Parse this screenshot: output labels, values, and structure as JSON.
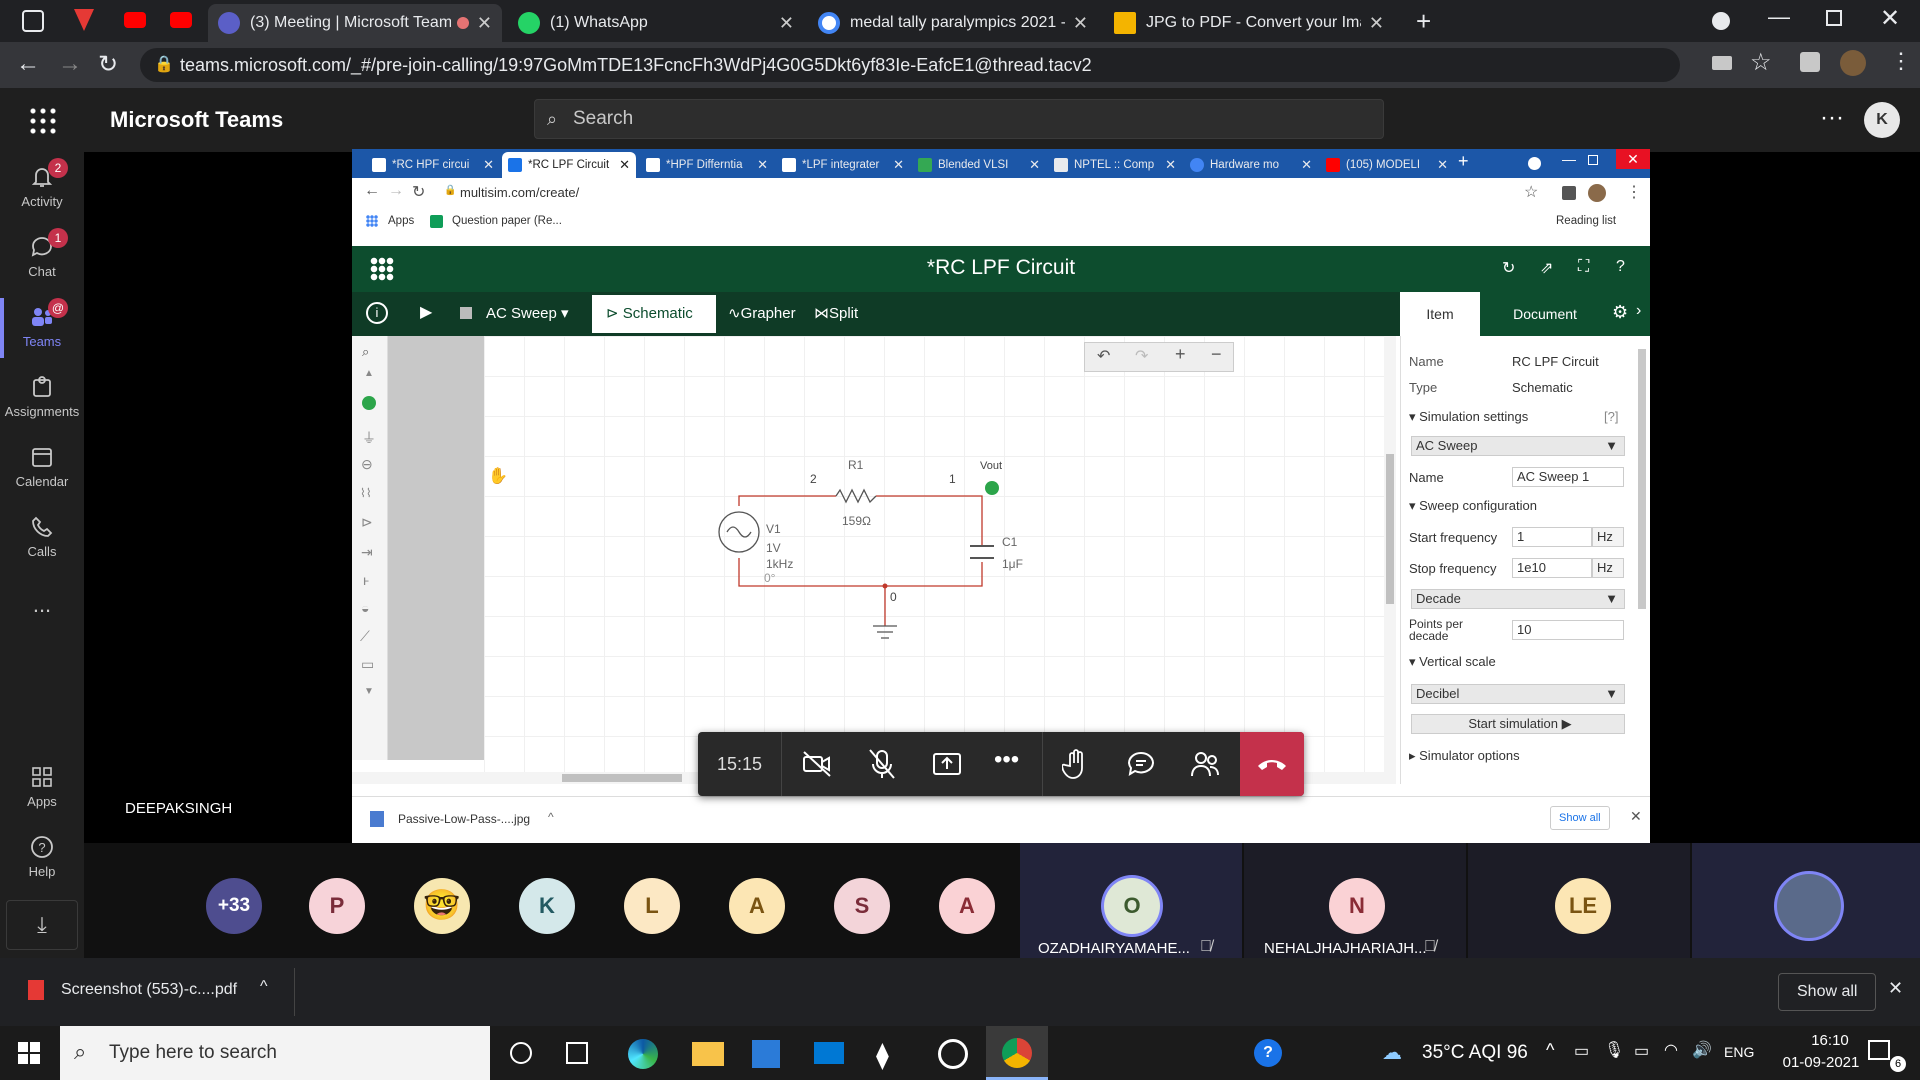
{
  "outer_browser": {
    "tabs": [
      {
        "title": "(3) Meeting | Microsoft Teams",
        "active": true,
        "fav": "#5b5fc7"
      },
      {
        "title": "(1) WhatsApp",
        "active": false,
        "fav": "#25d366"
      },
      {
        "title": "medal tally paralympics 2021 - G",
        "active": false,
        "fav": "#ffffff"
      },
      {
        "title": "JPG to PDF - Convert your Image",
        "active": false,
        "fav": "#f4b400"
      }
    ],
    "url": "teams.microsoft.com/_#/pre-join-calling/19:97GoMmTDE13FcncFh3WdPj4G0G5Dkt6yf83Ie-EafcE1@thread.tacv2"
  },
  "teams": {
    "app_title": "Microsoft Teams",
    "search_placeholder": "Search",
    "user_initial": "K",
    "rail": [
      {
        "label": "Activity",
        "badge": "2"
      },
      {
        "label": "Chat",
        "badge": "1"
      },
      {
        "label": "Teams",
        "badge": "@"
      },
      {
        "label": "Assignments",
        "badge": ""
      },
      {
        "label": "Calendar",
        "badge": ""
      },
      {
        "label": "Calls",
        "badge": ""
      },
      {
        "label": "...",
        "badge": ""
      },
      {
        "label": "Apps",
        "badge": ""
      },
      {
        "label": "Help",
        "badge": ""
      }
    ],
    "presenter_name": "DEEPAKSINGH"
  },
  "shared_screen": {
    "tabs": [
      {
        "title": "*RC HPF circui",
        "fav": "#1a73e8"
      },
      {
        "title": "*RC LPF Circuit",
        "fav": "#1a73e8",
        "active": true
      },
      {
        "title": "*HPF Differntia",
        "fav": "#1a73e8"
      },
      {
        "title": "*LPF integrater",
        "fav": "#1a73e8"
      },
      {
        "title": "Blended VLSI",
        "fav": "#34a853"
      },
      {
        "title": "NPTEL :: Comp",
        "fav": "#e8eaed"
      },
      {
        "title": "Hardware mo",
        "fav": "#4285f4"
      },
      {
        "title": "(105) MODELI",
        "fav": "#ff0000"
      }
    ],
    "url": "multisim.com/create/",
    "bookmarks": [
      "Apps",
      "Question paper (Re..."
    ],
    "reading_list": "Reading list",
    "multisim": {
      "title": "*RC LPF Circuit",
      "analysis": "AC Sweep",
      "views": [
        "Schematic",
        "Grapher",
        "Split"
      ],
      "panel_tabs": [
        "Item",
        "Document"
      ],
      "props": {
        "name_label": "Name",
        "name_value": "RC LPF Circuit",
        "type_label": "Type",
        "type_value": "Schematic",
        "sim_settings": "Simulation settings",
        "help": "[?]",
        "analysis_select": "AC Sweep",
        "analysis_name_label": "Name",
        "analysis_name_value": "AC Sweep 1",
        "sweep_config": "Sweep configuration",
        "start_label": "Start frequency",
        "start_value": "1",
        "start_unit": "Hz",
        "stop_label": "Stop frequency",
        "stop_value": "1e10",
        "stop_unit": "Hz",
        "sweep_type": "Decade",
        "points_label": "Points per decade",
        "points_value": "10",
        "vscale": "Vertical scale",
        "vscale_value": "Decibel",
        "start_sim": "Start simulation",
        "sim_options": "Simulator options"
      },
      "circuit": {
        "r_name": "R1",
        "r_value": "159Ω",
        "c_name": "C1",
        "c_value": "1μF",
        "v_name": "V1",
        "v_amp": "1V",
        "v_freq": "1kHz",
        "v_phase": "0°",
        "probe": "Vout",
        "node_2": "2",
        "node_1": "1",
        "node_0": "0"
      }
    },
    "download": {
      "file": "Passive-Low-Pass-....jpg",
      "show_all": "Show all"
    }
  },
  "call_controls": {
    "timer": "15:15"
  },
  "participants": [
    {
      "initials": "+33",
      "bg": "#4e4d8f",
      "fg": "#ffffff"
    },
    {
      "initials": "P",
      "bg": "#f7d3d9",
      "fg": "#7a2c3a"
    },
    {
      "initials": "K",
      "bg": "#d4e8ea",
      "fg": "#235a62"
    },
    {
      "initials": "L",
      "bg": "#fce8c4",
      "fg": "#7a5412"
    },
    {
      "initials": "A",
      "bg": "#fce6b4",
      "fg": "#7a5412"
    },
    {
      "initials": "S",
      "bg": "#f3d4d9",
      "fg": "#7a2c3a"
    },
    {
      "initials": "A",
      "bg": "#fad2d5",
      "fg": "#8a2c36"
    }
  ],
  "video_tiles": [
    {
      "initials": "O",
      "name": "OZADHAIRYAMAHE...",
      "bg": "#dfe8d6",
      "fg": "#3c5a2e"
    },
    {
      "initials": "N",
      "name": "NEHALJHAJHARIAJH...",
      "bg": "#fad2d5",
      "fg": "#8a2c36"
    },
    {
      "initials": "LE",
      "name": "",
      "bg": "#fce6b4",
      "fg": "#7a5412"
    }
  ],
  "download_bar": {
    "file": "Screenshot (553)-c....pdf",
    "show_all": "Show all"
  },
  "taskbar": {
    "search_placeholder": "Type here to search",
    "weather": "35°C  AQI 96",
    "lang": "ENG",
    "time": "16:10",
    "date": "01-09-2021",
    "notif": "6"
  }
}
